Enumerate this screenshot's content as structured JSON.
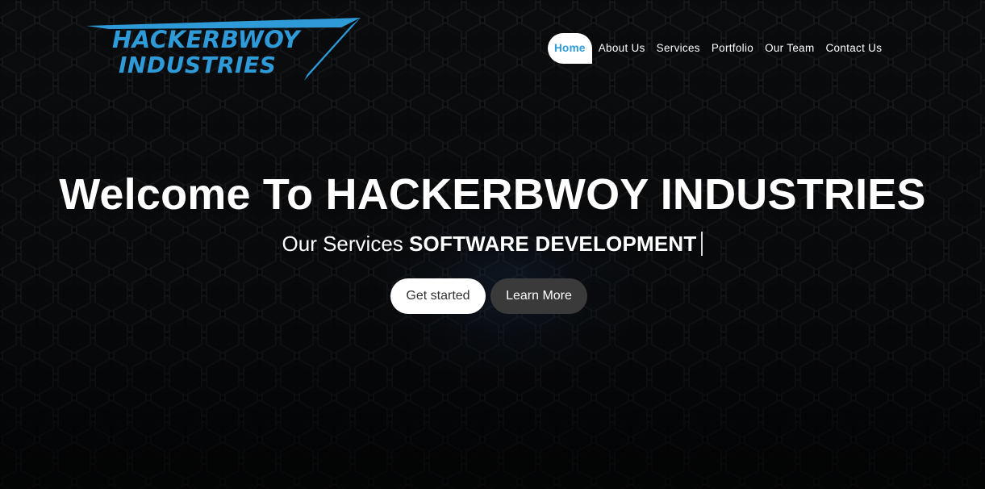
{
  "brand": {
    "logo_line1": "HACKERBWOY",
    "logo_line2": "INDUSTRIES",
    "logo_color": "#2e9ad8"
  },
  "nav": {
    "items": [
      {
        "label": "Home",
        "active": true
      },
      {
        "label": "About Us",
        "active": false
      },
      {
        "label": "Services",
        "active": false
      },
      {
        "label": "Portfolio",
        "active": false
      },
      {
        "label": "Our Team",
        "active": false
      },
      {
        "label": "Contact Us",
        "active": false
      }
    ],
    "active_color": "#2e9ad8"
  },
  "hero": {
    "title": "Welcome To HACKERBWOY INDUSTRIES",
    "subtitle_prefix": "Our Services",
    "subtitle_typed": "SOFTWARE DEVELOPMENT",
    "primary_button": "Get started",
    "secondary_button": "Learn More"
  },
  "theme": {
    "background": "#050607",
    "text": "#ffffff",
    "secondary_button_bg": "#3a3a3a"
  }
}
